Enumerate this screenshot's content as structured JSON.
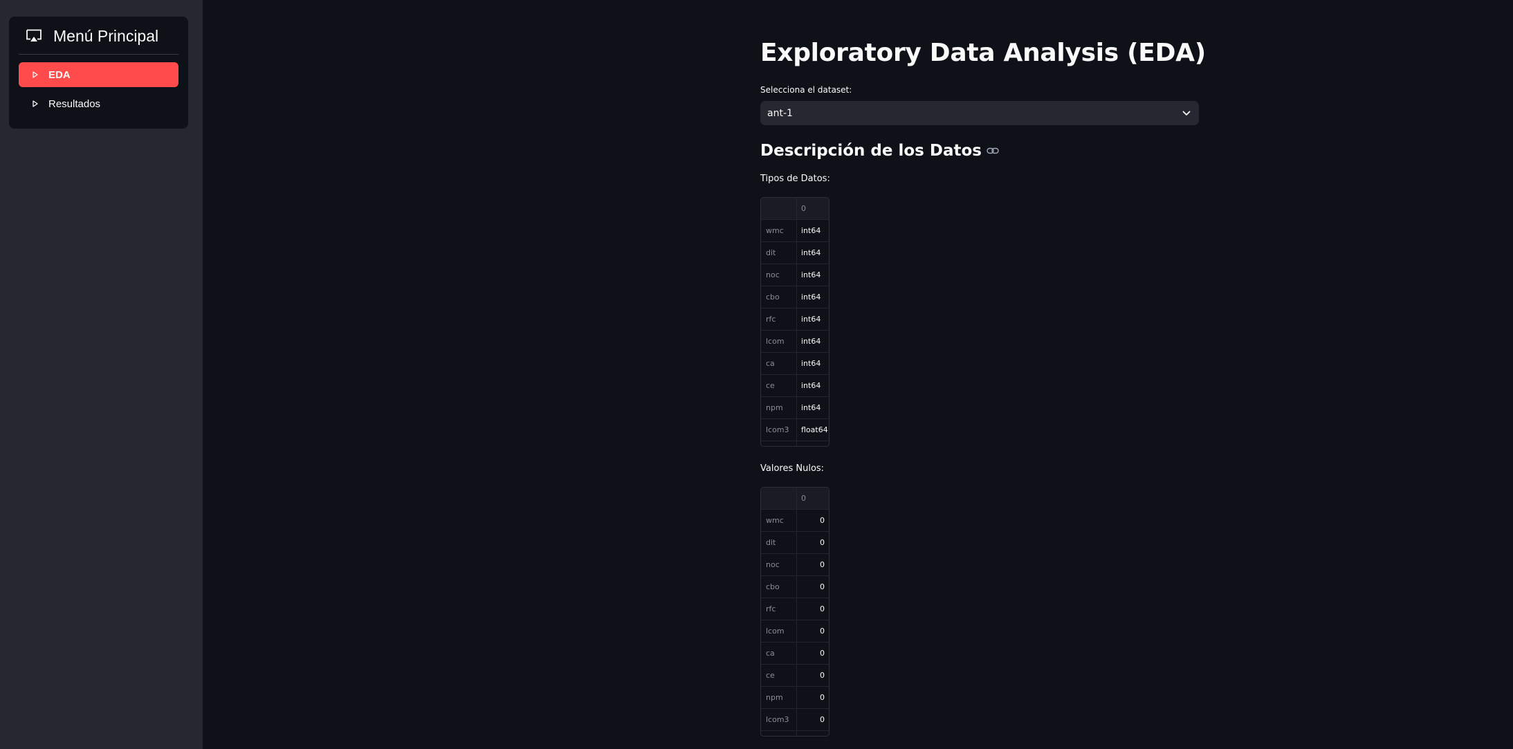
{
  "sidebar": {
    "menu_title": "Menú Principal",
    "menu_icon": "cast-icon",
    "items": [
      {
        "label": "EDA",
        "active": true,
        "icon": "caret-right-icon"
      },
      {
        "label": "Resultados",
        "active": false,
        "icon": "caret-right-icon"
      }
    ],
    "active_color": "#ff4b4b"
  },
  "main": {
    "title": "Exploratory Data Analysis (EDA)",
    "dataset_select": {
      "label": "Selecciona el dataset:",
      "value": "ant-1"
    },
    "section_title": "Descripción de los Datos",
    "types_label": "Tipos de Datos:",
    "nulls_label": "Valores Nulos:",
    "types_table": {
      "column_header": "0",
      "rows": [
        {
          "index": "wmc",
          "value": "int64"
        },
        {
          "index": "dit",
          "value": "int64"
        },
        {
          "index": "noc",
          "value": "int64"
        },
        {
          "index": "cbo",
          "value": "int64"
        },
        {
          "index": "rfc",
          "value": "int64"
        },
        {
          "index": "lcom",
          "value": "int64"
        },
        {
          "index": "ca",
          "value": "int64"
        },
        {
          "index": "ce",
          "value": "int64"
        },
        {
          "index": "npm",
          "value": "int64"
        },
        {
          "index": "lcom3",
          "value": "float64"
        }
      ]
    },
    "nulls_table": {
      "column_header": "0",
      "rows": [
        {
          "index": "wmc",
          "value": "0"
        },
        {
          "index": "dit",
          "value": "0"
        },
        {
          "index": "noc",
          "value": "0"
        },
        {
          "index": "cbo",
          "value": "0"
        },
        {
          "index": "rfc",
          "value": "0"
        },
        {
          "index": "lcom",
          "value": "0"
        },
        {
          "index": "ca",
          "value": "0"
        },
        {
          "index": "ce",
          "value": "0"
        },
        {
          "index": "npm",
          "value": "0"
        },
        {
          "index": "lcom3",
          "value": "0"
        }
      ]
    }
  }
}
